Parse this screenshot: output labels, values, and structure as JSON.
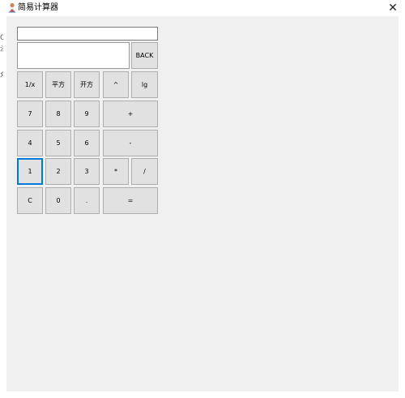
{
  "window": {
    "title": "简易计算器",
    "close_symbol": "✕"
  },
  "background_glyphs": [
    "Q",
    "法",
    "众"
  ],
  "display": {
    "top_value": "",
    "main_value": ""
  },
  "buttons": {
    "back": "BACK",
    "reciprocal": "1/x",
    "square": "平方",
    "sqrt": "开方",
    "power": "^",
    "log": "lg",
    "d7": "7",
    "d8": "8",
    "d9": "9",
    "plus": "+",
    "d4": "4",
    "d5": "5",
    "d6": "6",
    "minus": "-",
    "d1": "1",
    "d2": "2",
    "d3": "3",
    "multiply": "*",
    "divide": "/",
    "clear": "C",
    "d0": "0",
    "dot": ".",
    "equals": "="
  },
  "colors": {
    "client_bg": "#f0f0f0",
    "button_bg": "#e1e1e1",
    "button_border": "#adadad",
    "focus_border": "#0078d7"
  }
}
